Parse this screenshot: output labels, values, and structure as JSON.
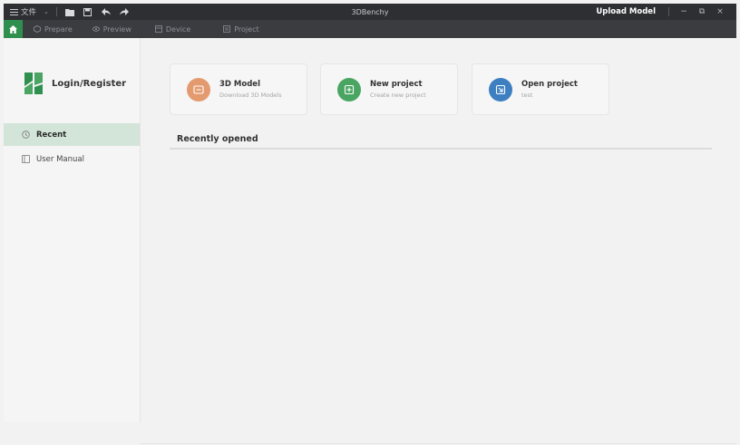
{
  "titlebar": {
    "menu_label": "文件",
    "window_title": "3DBenchy",
    "upload_label": "Upload Model",
    "minimize": "−",
    "restore": "⧉",
    "close": "×"
  },
  "tabs": [
    {
      "label": "Prepare",
      "icon": "cube-icon"
    },
    {
      "label": "Preview",
      "icon": "eye-icon"
    },
    {
      "label": "Device",
      "icon": "device-icon"
    },
    {
      "label": "Project",
      "icon": "project-icon"
    }
  ],
  "sidebar": {
    "login_label": "Login/Register",
    "items": [
      {
        "label": "Recent",
        "icon": "clock-icon"
      },
      {
        "label": "User Manual",
        "icon": "book-icon"
      }
    ]
  },
  "cards": [
    {
      "title": "3D Model",
      "subtitle": "Download 3D Models",
      "color": "#e39a6e"
    },
    {
      "title": "New project",
      "subtitle": "Create new project",
      "color": "#4aa563"
    },
    {
      "title": "Open project",
      "subtitle": "test",
      "color": "#3d7fc1"
    }
  ],
  "recent": {
    "title": "Recently opened"
  },
  "colors": {
    "accent": "#2f8f4e",
    "titlebar_bg": "#2d2f33",
    "tabbar_bg": "#3a3c40",
    "active_nav_bg": "#d3e5d9"
  }
}
